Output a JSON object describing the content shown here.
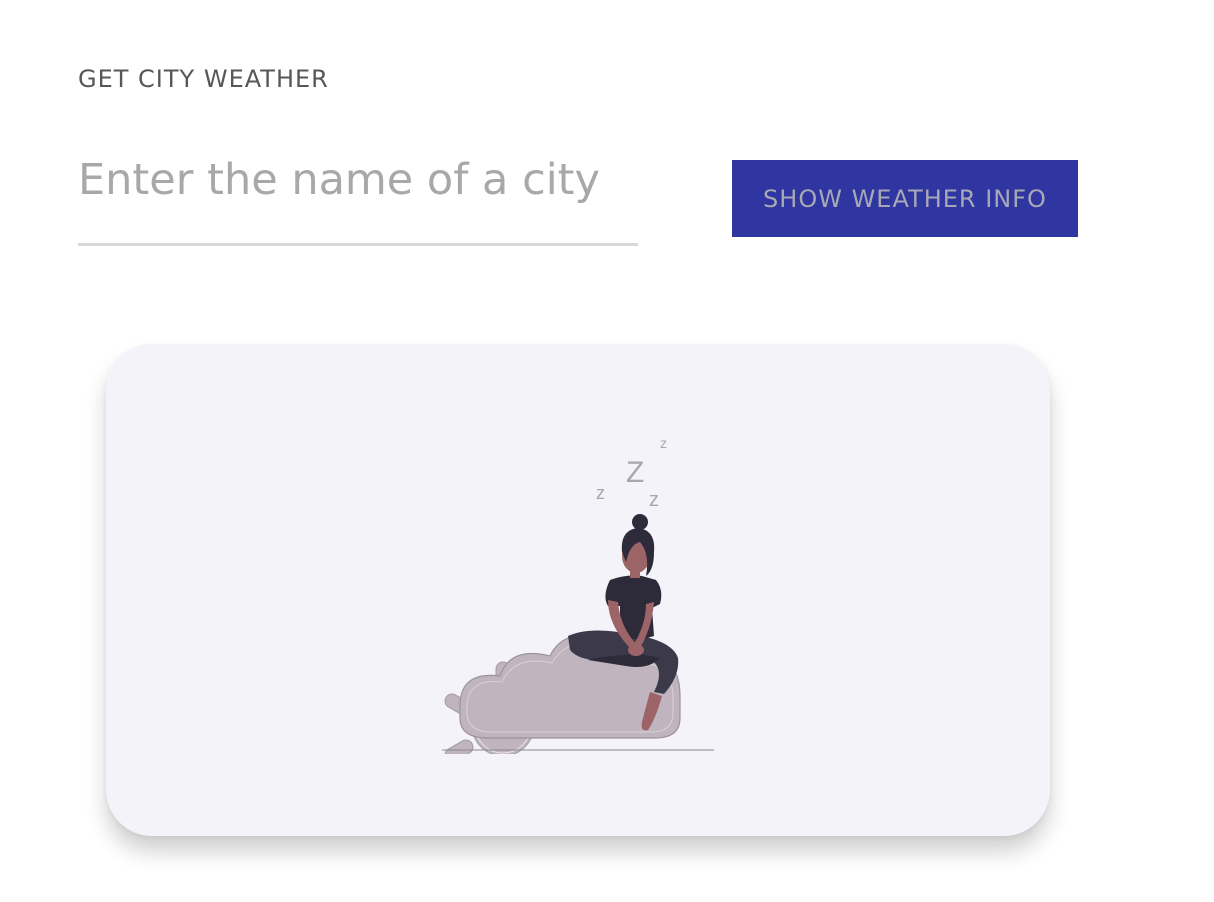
{
  "page": {
    "heading": "GET CITY WEATHER"
  },
  "search": {
    "placeholder": "Enter the name of a city",
    "value": ""
  },
  "actions": {
    "show_label": "SHOW WEATHER INFO"
  },
  "empty_state": {
    "illustration": "sleeping-on-cloud-illustration",
    "zzz": [
      "z",
      "Z",
      "z",
      "z"
    ]
  },
  "colors": {
    "button_bg": "#2f35a1",
    "button_text": "#a8a8b4",
    "card_bg": "#f4f3f9",
    "heading_text": "#575757",
    "placeholder_text": "#a8a8a8",
    "cloud": "#c0b5be",
    "figure_dark": "#2d2a3a",
    "skin": "#9c6467"
  }
}
